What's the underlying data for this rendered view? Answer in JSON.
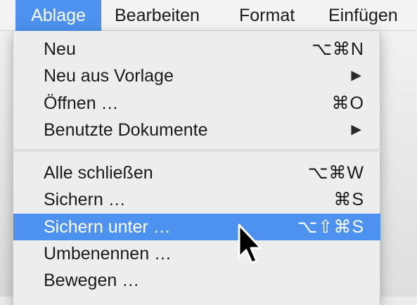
{
  "menubar": {
    "items": [
      {
        "label": "Ablage",
        "active": true
      },
      {
        "label": "Bearbeiten",
        "active": false
      },
      {
        "label": "Format",
        "active": false
      },
      {
        "label": "Einfügen",
        "active": false
      }
    ]
  },
  "menu": {
    "items": [
      {
        "label": "Neu",
        "shortcut": "⌥⌘N"
      },
      {
        "label": "Neu aus Vorlage",
        "submenu_icon": "▶"
      },
      {
        "label": "Öffnen …",
        "shortcut": "⌘O"
      },
      {
        "label": "Benutzte Dokumente",
        "submenu_icon": "▶"
      },
      {
        "label": "Alle schließen",
        "shortcut": "⌥⌘W"
      },
      {
        "label": "Sichern …",
        "shortcut": "⌘S"
      },
      {
        "label": "Sichern unter …",
        "shortcut": "⌥⇧⌘S",
        "highlighted": true
      },
      {
        "label": "Umbenennen …"
      },
      {
        "label": "Bewegen …"
      }
    ]
  },
  "colors": {
    "accent": "#4c92ee",
    "menu_background": "#ededed",
    "menubar_background": "#f3f3f3"
  },
  "icons": {
    "submenu": "submenu-arrow-icon",
    "cursor": "mouse-pointer-icon"
  }
}
